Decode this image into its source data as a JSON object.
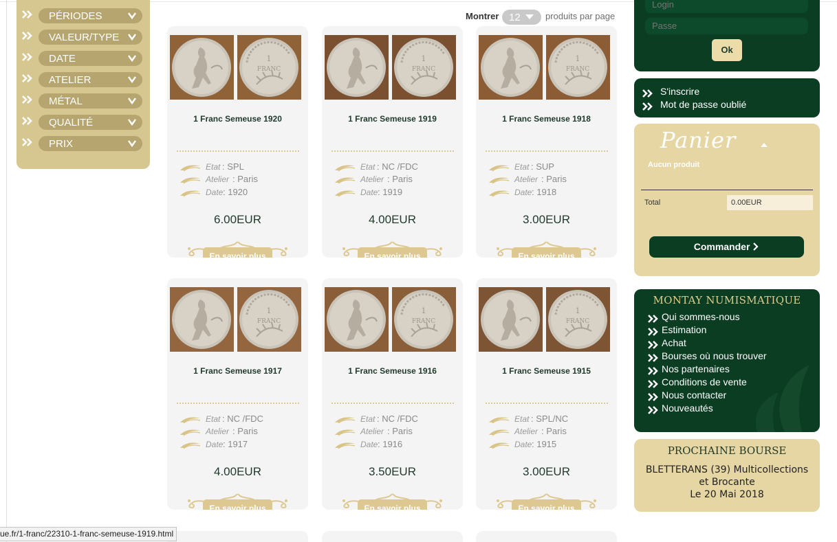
{
  "filters": {
    "items": [
      {
        "label": "PÉRIODES"
      },
      {
        "label": "VALEUR/TYPE"
      },
      {
        "label": "DATE"
      },
      {
        "label": "ATELIER"
      },
      {
        "label": "MÉTAL"
      },
      {
        "label": "QUALITÉ"
      },
      {
        "label": "PRIX"
      }
    ]
  },
  "show_bar": {
    "label": "Montrer",
    "per_page_value": "12",
    "per_page_text": "produits par page"
  },
  "attr_labels": {
    "etat": "Etat",
    "atelier": "Atelier",
    "date": "Date"
  },
  "products": [
    {
      "title": "1 Franc Semeuse 1920",
      "etat": ": SPL",
      "atelier": ": Paris",
      "date": ": 1920",
      "price": "6.00EUR",
      "more": "En savoir plus"
    },
    {
      "title": "1 Franc Semeuse 1919",
      "etat": ": NC /FDC",
      "atelier": ": Paris",
      "date": ": 1919",
      "price": "4.00EUR",
      "more": "En savoir plus"
    },
    {
      "title": "1 Franc Semeuse 1918",
      "etat": ": SUP",
      "atelier": ": Paris",
      "date": ": 1918",
      "price": "3.00EUR",
      "more": "En savoir plus"
    },
    {
      "title": "1 Franc Semeuse 1917",
      "etat": ": NC /FDC",
      "atelier": ": Paris",
      "date": ": 1917",
      "price": "4.00EUR",
      "more": "En savoir plus"
    },
    {
      "title": "1 Franc Semeuse 1916",
      "etat": ": NC /FDC",
      "atelier": ": Paris",
      "date": ": 1916",
      "price": "3.50EUR",
      "more": "En savoir plus"
    },
    {
      "title": "1 Franc Semeuse 1915",
      "etat": ": SPL/NC",
      "atelier": ": Paris",
      "date": ": 1915",
      "price": "3.00EUR",
      "more": "En savoir plus"
    }
  ],
  "login": {
    "login_placeholder": "Login",
    "password_placeholder": "Passe",
    "ok_label": "Ok"
  },
  "account_links": [
    {
      "label": "S'inscrire"
    },
    {
      "label": "Mot de passe oublié"
    }
  ],
  "cart": {
    "title": "Panier",
    "empty_text": "Aucun produit",
    "total_label": "Total",
    "total_value": "0.00EUR",
    "order_label": "Commander"
  },
  "info": {
    "title": "MONTAY NUMISMATIQUE",
    "links": [
      {
        "label": "Qui sommes-nous"
      },
      {
        "label": "Estimation"
      },
      {
        "label": "Achat"
      },
      {
        "label": "Bourses où nous trouver"
      },
      {
        "label": "Nos partenaires"
      },
      {
        "label": "Conditions de vente"
      },
      {
        "label": "Nous contacter"
      },
      {
        "label": "Nouveautés"
      }
    ]
  },
  "bourse": {
    "title": "PROCHAINE BOURSE",
    "line1": "BLETTERANS (39) Multicollections",
    "line2": "et Brocante",
    "line3": "Le 20 Mai 2018"
  },
  "status_bar": {
    "url": "ue.fr/1-franc/22310-1-franc-semeuse-1919.html"
  },
  "colors": {
    "dark_green": "#0a3d22",
    "gold": "#d6c690",
    "beige": "#e6d6a4"
  }
}
